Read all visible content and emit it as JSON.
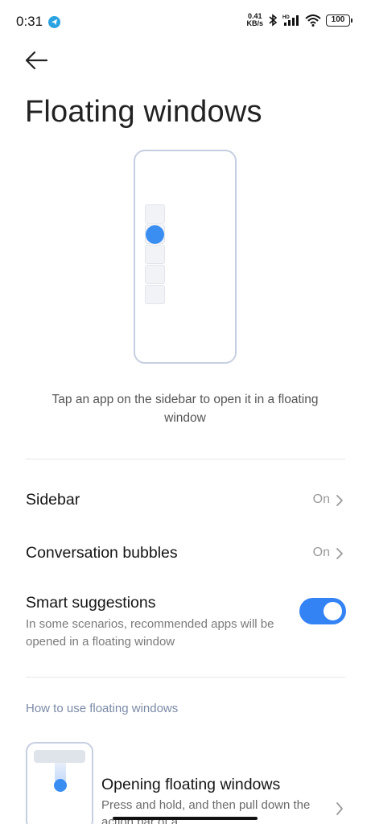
{
  "status_bar": {
    "time": "0:31",
    "net_speed_value": "0.41",
    "net_speed_unit": "KB/s",
    "network_label": "HD",
    "battery": "100"
  },
  "page": {
    "title": "Floating windows",
    "caption": "Tap an app on the sidebar to open it in a floating window"
  },
  "settings": [
    {
      "label": "Sidebar",
      "value": "On"
    },
    {
      "label": "Conversation bubbles",
      "value": "On"
    }
  ],
  "smart_suggestions": {
    "label": "Smart suggestions",
    "description": "In some scenarios, recommended apps will be opened in a floating window",
    "enabled": true
  },
  "howto": {
    "section_header": "How to use floating windows",
    "card_title": "Opening floating windows",
    "card_desc": "Press and hold, and then pull down the action bar of a"
  },
  "colors": {
    "accent": "#3483f5",
    "illustration_border": "#c6cfe1",
    "section_header": "#7b8aa6"
  },
  "icons": {
    "back": "arrow-left-icon",
    "chevron": "chevron-right-icon",
    "telegram": "telegram-icon"
  }
}
